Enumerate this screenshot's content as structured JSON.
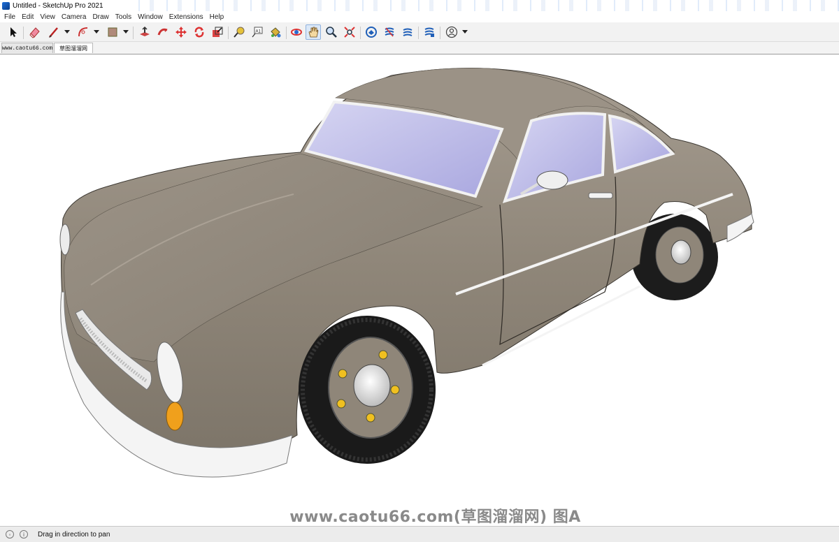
{
  "window": {
    "title": "Untitled - SketchUp Pro 2021"
  },
  "menu": [
    "File",
    "Edit",
    "View",
    "Camera",
    "Draw",
    "Tools",
    "Window",
    "Extensions",
    "Help"
  ],
  "toolbar": {
    "tools": [
      {
        "name": "select-tool-icon"
      },
      {
        "name": "eraser-tool-icon"
      },
      {
        "name": "line-tool-icon"
      },
      {
        "name": "arc-tool-icon"
      },
      {
        "name": "rectangle-tool-icon"
      },
      {
        "name": "push-pull-tool-icon"
      },
      {
        "name": "follow-me-tool-icon"
      },
      {
        "name": "move-tool-icon"
      },
      {
        "name": "rotate-tool-icon"
      },
      {
        "name": "scale-tool-icon"
      },
      {
        "name": "tape-measure-tool-icon"
      },
      {
        "name": "text-tool-icon",
        "text": "A1"
      },
      {
        "name": "paint-bucket-tool-icon"
      },
      {
        "name": "orbit-tool-icon"
      },
      {
        "name": "pan-tool-icon",
        "active": true
      },
      {
        "name": "zoom-tool-icon"
      },
      {
        "name": "zoom-extents-tool-icon"
      },
      {
        "name": "3d-warehouse-icon"
      },
      {
        "name": "extension-warehouse-icon"
      },
      {
        "name": "layout-icon"
      },
      {
        "name": "extension-manager-icon"
      },
      {
        "name": "account-icon"
      }
    ]
  },
  "tabs": [
    {
      "label": "www.caotu66.com"
    },
    {
      "label": "草图溜溜网",
      "active": true
    }
  ],
  "viewport": {
    "watermark": "www.caotu66.com(草图溜溜网) 图A",
    "model_color": "#8f8679"
  },
  "status": {
    "hint": "Drag in direction to pan",
    "icons": [
      "geo-location-icon",
      "info-icon"
    ]
  },
  "colors": {
    "toolbar_bg": "#f2f2f2",
    "accent": "#1e6fd9",
    "car_body": "#8f8679",
    "glass": "#b4b3e6",
    "chrome": "#f4f4f4",
    "indicator": "#f0a01c"
  }
}
